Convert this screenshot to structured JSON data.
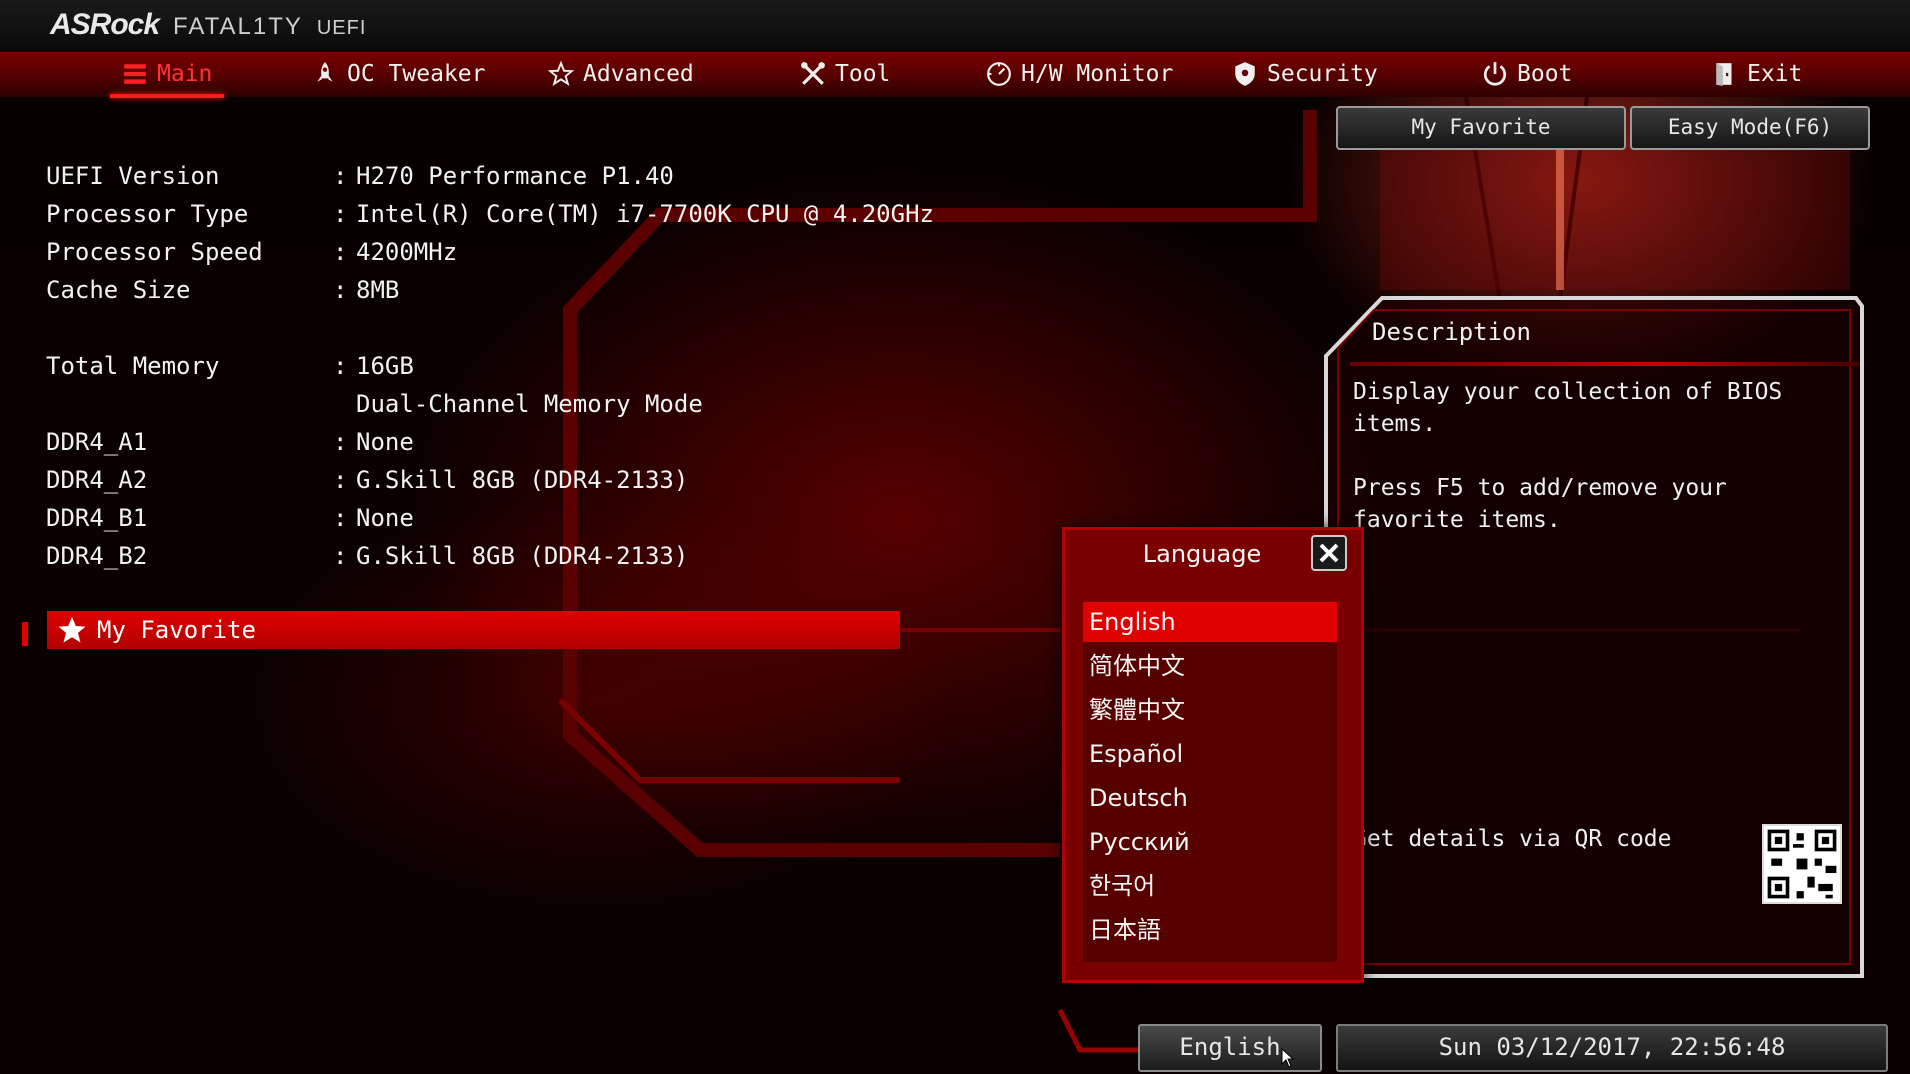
{
  "brand": {
    "name": "ASRock",
    "series": "FATAL1TY",
    "product": "UEFI"
  },
  "tabs": [
    {
      "label": "Main",
      "icon": "list-icon",
      "active": true
    },
    {
      "label": "OC Tweaker",
      "icon": "rocket-icon",
      "active": false
    },
    {
      "label": "Advanced",
      "icon": "star-outline-icon",
      "active": false
    },
    {
      "label": "Tool",
      "icon": "tools-icon",
      "active": false
    },
    {
      "label": "H/W Monitor",
      "icon": "monitor-dial-icon",
      "active": false
    },
    {
      "label": "Security",
      "icon": "shield-icon",
      "active": false
    },
    {
      "label": "Boot",
      "icon": "power-icon",
      "active": false
    },
    {
      "label": "Exit",
      "icon": "exit-door-icon",
      "active": false
    }
  ],
  "header_buttons": {
    "my_favorite": "My Favorite",
    "easy_mode": "Easy Mode(F6)"
  },
  "info": [
    {
      "label": "UEFI Version",
      "colon": ":",
      "value": "H270 Performance P1.40"
    },
    {
      "label": "Processor Type",
      "colon": ":",
      "value": "Intel(R) Core(TM) i7-7700K CPU @ 4.20GHz"
    },
    {
      "label": "Processor Speed",
      "colon": ":",
      "value": "4200MHz"
    },
    {
      "label": "Cache Size",
      "colon": ":",
      "value": "8MB"
    },
    {
      "label": "Total Memory",
      "colon": ":",
      "value": "16GB"
    },
    {
      "label": "",
      "colon": "",
      "value": "Dual-Channel Memory Mode"
    },
    {
      "label": "DDR4_A1",
      "colon": ":",
      "value": "None"
    },
    {
      "label": "DDR4_A2",
      "colon": ":",
      "value": "G.Skill 8GB (DDR4-2133)"
    },
    {
      "label": "DDR4_B1",
      "colon": ":",
      "value": "None"
    },
    {
      "label": "DDR4_B2",
      "colon": ":",
      "value": "G.Skill 8GB (DDR4-2133)"
    }
  ],
  "favorite_item": {
    "label": "My Favorite",
    "icon": "star-icon"
  },
  "description": {
    "title": "Description",
    "text1": "Display your collection of BIOS items.",
    "text2": "Press F5 to add/remove your favorite items.",
    "qr_label": "Get details via QR code"
  },
  "language_popup": {
    "title": "Language",
    "options": [
      "English",
      "简体中文",
      "繁體中文",
      "Español",
      "Deutsch",
      "Русский",
      "한국어",
      "日本語"
    ],
    "selected_index": 0
  },
  "footer": {
    "language": "English",
    "datetime": "Sun 03/12/2017, 22:56:48"
  },
  "colors": {
    "accent": "#e00000",
    "tab_bar": "#6a0000",
    "popup": "#7a0000"
  }
}
